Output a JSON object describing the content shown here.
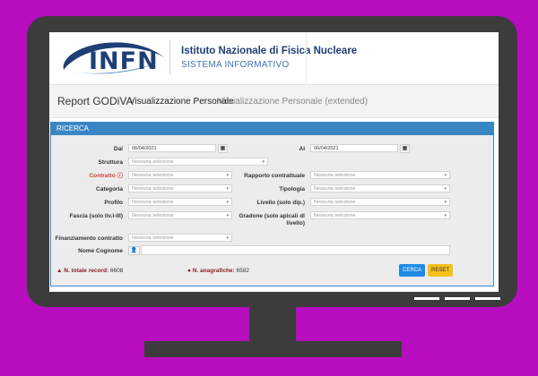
{
  "header": {
    "logo_text": "INFN",
    "org_name": "Istituto Nazionale di Fisica Nucleare",
    "system_name": "SISTEMA INFORMATIVO"
  },
  "nav": {
    "brand": "Report GODiVA",
    "items": [
      {
        "label": "Visualizzazione Personale",
        "active": true
      },
      {
        "label": "Visualizzazione Personale (extended)",
        "active": false
      }
    ]
  },
  "search": {
    "title": "RICERCA",
    "dal_label": "Dal",
    "dal_value": "06/04/2021",
    "al_label": "Al",
    "al_value": "06/04/2021",
    "placeholder": "Nessuna selezione",
    "labels": {
      "struttura": "Struttura",
      "contratto": "Contratto",
      "rapporto": "Rapporto contrattuale",
      "categoria": "Categoria",
      "tipologia": "Tipologia",
      "profilo": "Profilo",
      "livello": "Livello (solo dip.)",
      "fascia": "Fascia (solo liv.I-III)",
      "gradone_1": "Gradone (solo apicali di",
      "gradone_2": "livello)",
      "finanziamento": "Finanziamento contratto",
      "nome": "Nome Cognome"
    },
    "stats": {
      "record_label": "N. totale record:",
      "record_value": "6608",
      "anagrafiche_label": "N. anagrafiche:",
      "anagrafiche_value": "6582"
    },
    "buttons": {
      "cerca": "CERCA",
      "reset": "RESET"
    }
  },
  "colors": {
    "background": "#b80dbf",
    "monitor": "#3c3c3c",
    "panel_header": "#3a86c5",
    "brand_blue": "#1d3f76"
  }
}
